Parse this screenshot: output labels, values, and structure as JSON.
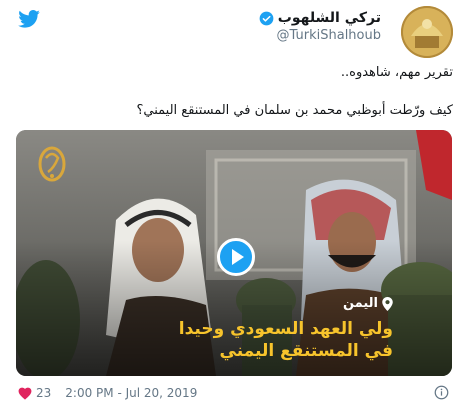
{
  "header": {
    "display_name": "تركي الشلهوب",
    "handle": "@TurkiShalhoub",
    "verified": true
  },
  "tweet": {
    "line1": "تقرير مهم، شاهدوه..",
    "line2": "كيف ورّطت أبوظبي محمد بن سلمان في المستنقع اليمني؟"
  },
  "media": {
    "location": "اليمن",
    "caption_line1": "ولي العهد السعودي وحيدا",
    "caption_line2": "في المستنقع اليمني",
    "caption_color": "#f7c42c"
  },
  "footer": {
    "likes": "23",
    "timestamp": "2:00 PM - Jul 20, 2019"
  },
  "colors": {
    "twitter_blue": "#1da1f2",
    "muted_text": "#657786",
    "heart_red": "#e0245e"
  },
  "icons": [
    "twitter-logo-icon",
    "verified-icon",
    "play-icon",
    "pin-icon",
    "heart-icon",
    "info-icon",
    "al-jazeera-logo"
  ]
}
